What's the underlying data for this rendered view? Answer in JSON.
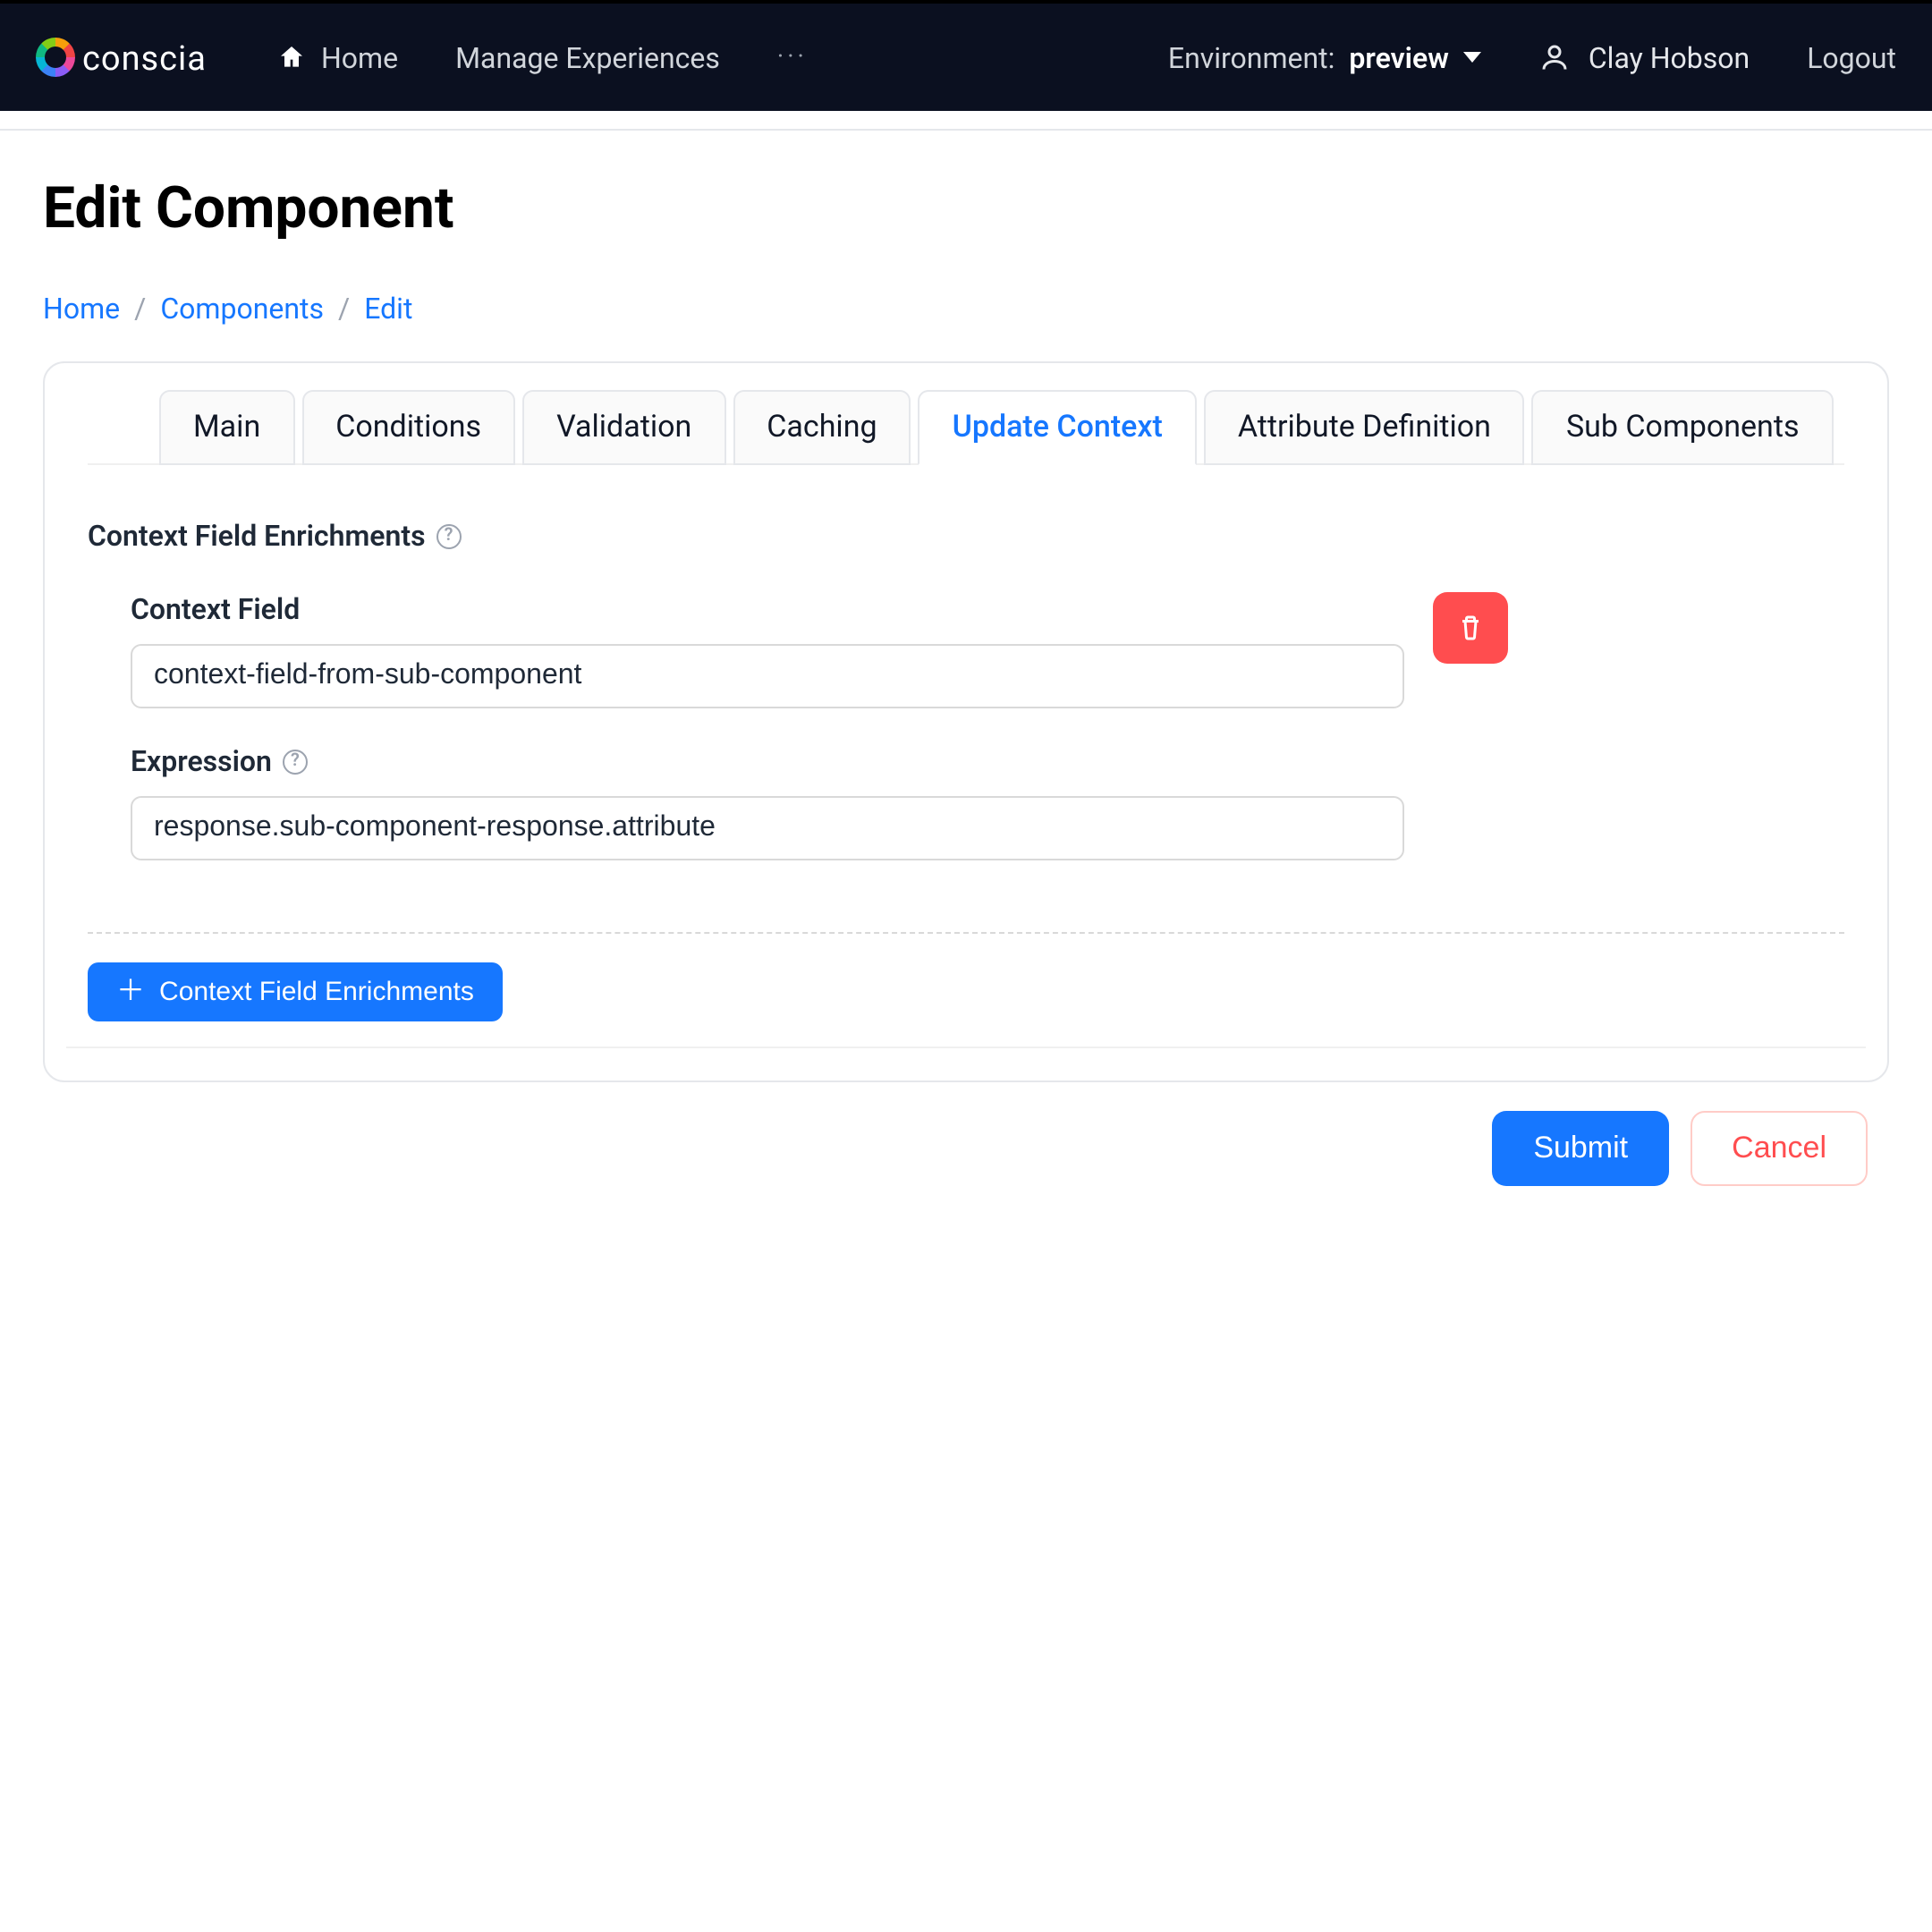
{
  "brand": "conscia",
  "nav": {
    "home": "Home",
    "manage": "Manage Experiences",
    "more": "···"
  },
  "env": {
    "label": "Environment:",
    "value": "preview"
  },
  "user": {
    "name": "Clay Hobson",
    "logout": "Logout"
  },
  "page": {
    "title": "Edit Component"
  },
  "breadcrumb": {
    "home": "Home",
    "components": "Components",
    "edit": "Edit"
  },
  "tabs": {
    "main": "Main",
    "conditions": "Conditions",
    "validation": "Validation",
    "caching": "Caching",
    "update_context": "Update Context",
    "attribute_definition": "Attribute Definition",
    "sub_components": "Sub Components"
  },
  "section": {
    "title": "Context Field Enrichments"
  },
  "enrichment": {
    "context_field_label": "Context Field",
    "context_field_value": "context-field-from-sub-component",
    "expression_label": "Expression",
    "expression_value": "response.sub-component-response.attribute"
  },
  "add_button": "Context Field Enrichments",
  "actions": {
    "submit": "Submit",
    "cancel": "Cancel"
  }
}
